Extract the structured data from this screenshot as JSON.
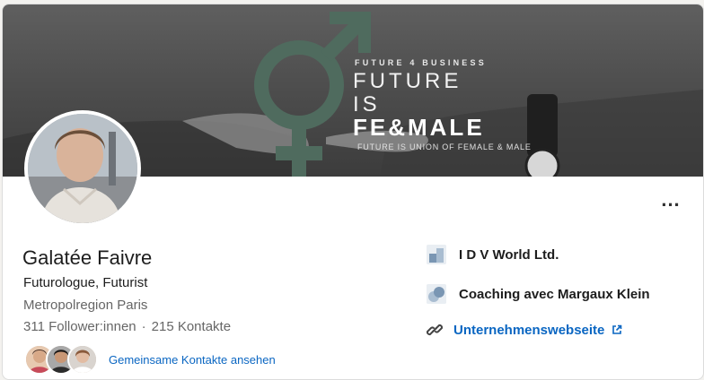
{
  "banner": {
    "overline": "FUTURE 4 BUSINESS",
    "line1": "FUTURE",
    "line2": "IS",
    "line3": "FE&MALE",
    "tagline": "FUTURE IS UNION OF FEMALE & MALE",
    "symbol_color": "#4f6b5e"
  },
  "profile": {
    "name": "Galatée Faivre",
    "headline": "Futurologue, Futurist",
    "location": "Metropolregion Paris",
    "followers": "311 Follower:innen",
    "separator": "·",
    "connections": "215 Kontakte",
    "mutual_link": "Gemeinsame Kontakte ansehen"
  },
  "more_button": {
    "label": "..."
  },
  "right_panel": {
    "company": "I D V World Ltd.",
    "coaching": "Coaching avec Margaux Klein",
    "website": "Unternehmenswebseite"
  },
  "colors": {
    "link": "#0a66c2",
    "text_secondary": "#666666"
  },
  "icons": [
    "avatar-photo",
    "more-icon",
    "company-logo",
    "coaching-logo",
    "link-icon",
    "external-link-icon"
  ]
}
